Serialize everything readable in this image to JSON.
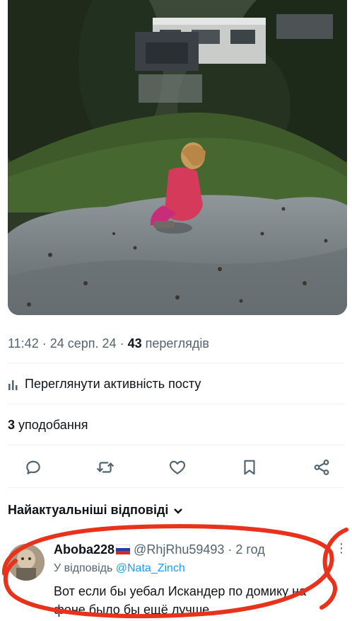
{
  "post": {
    "time": "11:42",
    "date": "24 серп. 24",
    "views_count": "43",
    "views_label": "переглядів",
    "activity_label": "Переглянути активність посту",
    "likes_count": "3",
    "likes_label": "уподобання"
  },
  "actions": {
    "icons": [
      "reply-icon",
      "retweet-icon",
      "like-icon",
      "bookmark-icon",
      "share-icon"
    ]
  },
  "replies": {
    "header": "Найактуальніші відповіді",
    "items": [
      {
        "name": "Aboba228",
        "flag": "flag-ru",
        "handle": "@RhjRhu59493",
        "time": "2 год",
        "reply_to_label": "У відповідь",
        "reply_to_mention": "@Nata_Zinch",
        "text": "Вот если бы уебал Искандер по домику на фоне было бы ещё лучше",
        "more": "⋮"
      }
    ]
  },
  "colors": {
    "text": "#0f1419",
    "secondary": "#536471",
    "link": "#1d9bf0",
    "annotation": "#e8321c"
  }
}
